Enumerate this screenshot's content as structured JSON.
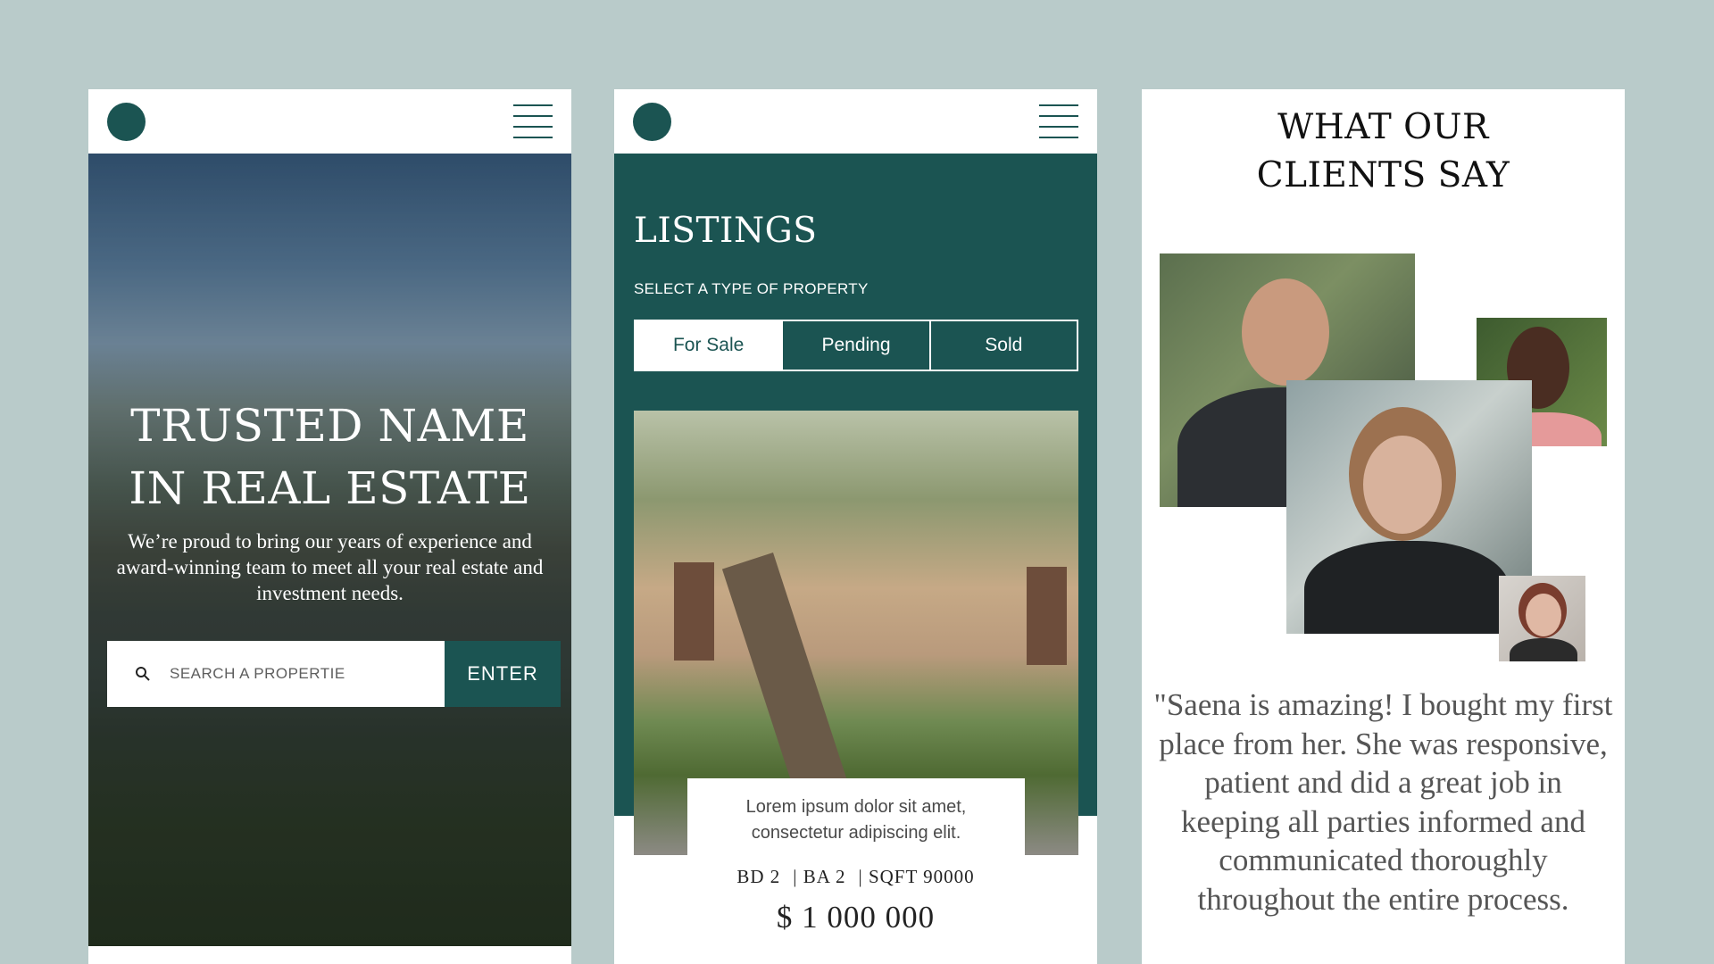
{
  "colors": {
    "background": "#b9cbca",
    "brand": "#1b5452",
    "white": "#ffffff"
  },
  "phone1": {
    "hero": {
      "title_line1": "TRUSTED NAME",
      "title_line2": "IN REAL ESTATE",
      "body": "We’re proud to bring our years of experience and award-winning team to meet all your real estate and investment needs."
    },
    "search": {
      "placeholder": "SEARCH A PROPERTIE",
      "button_label": "ENTER",
      "icon": "search-icon"
    }
  },
  "phone2": {
    "title": "LISTINGS",
    "subtitle": "SELECT A TYPE OF PROPERTY",
    "tabs": [
      {
        "label": "For Sale",
        "active": true
      },
      {
        "label": "Pending",
        "active": false
      },
      {
        "label": "Sold",
        "active": false
      }
    ],
    "listing": {
      "description_line1": "Lorem ipsum dolor sit amet,",
      "description_line2": "consectetur adipiscing elit.",
      "bd": "BD 2",
      "ba": "| BA 2",
      "sqft": "| SQFT 90000",
      "price": "$ 1 000 000"
    }
  },
  "phone3": {
    "title_line1": "WHAT OUR",
    "title_line2": "CLIENTS SAY",
    "quote": "\"Saena is amazing! I bought my first place from her. She was responsive, patient and did a great job in keeping all parties informed and communicated thoroughly throughout the entire process."
  }
}
